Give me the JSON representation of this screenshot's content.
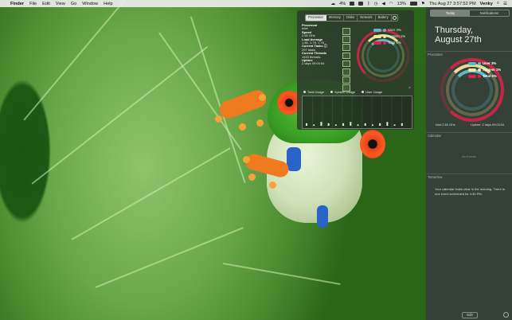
{
  "menubar": {
    "apple": "",
    "app": "Finder",
    "items": [
      "File",
      "Edit",
      "View",
      "Go",
      "Window",
      "Help"
    ],
    "status_percent": "4%",
    "battery": "13%",
    "datetime": "Thu Aug 27  3:57:52 PM",
    "user": "Venky"
  },
  "widget": {
    "tabs": [
      "Processor",
      "Memory",
      "Disks",
      "Network",
      "Battery"
    ],
    "active_tab": "Processor",
    "stats": [
      {
        "label": "Processor",
        "value": "Intel"
      },
      {
        "label": "Speed",
        "value": "2.50 GHz"
      },
      {
        "label": "Load Average",
        "value": "1.80, 1.79, 1.78"
      },
      {
        "label": "Current Tasks",
        "value": "297 tasks"
      },
      {
        "label": "Current Threads",
        "value": "1493 threads"
      },
      {
        "label": "Uptime",
        "value": "2 days 09:04:54"
      }
    ],
    "legend": [
      {
        "label": "User 4%",
        "color": "#5fb8c8"
      },
      {
        "label": "System 1%",
        "color": "#f2e6a0"
      },
      {
        "label": "Total 6%",
        "color": "#e0234a"
      }
    ],
    "graph_legend": [
      "Total Usage",
      "System Usage",
      "User Usage"
    ],
    "graph_values": [
      2,
      1,
      3,
      2,
      1,
      2,
      3,
      1,
      2,
      1,
      2,
      3,
      1,
      2
    ]
  },
  "nc": {
    "tabs": [
      "Today",
      "Notifications"
    ],
    "active_tab": "Today",
    "date_line1": "Thursday,",
    "date_line2": "August 27th",
    "processor_title": "Processor",
    "legend": [
      {
        "label": "User 3%",
        "color": "#5fb8c8"
      },
      {
        "label": "System 1%",
        "color": "#f2e6a0"
      },
      {
        "label": "Total 5%",
        "color": "#e0234a"
      }
    ],
    "footer_left": "Intel 2.50 GHz",
    "footer_right": "Uptime: 2 days 09:04:54",
    "calendar_title": "Calendar",
    "no_events": "No Events",
    "tomorrow_title": "Tomorrow",
    "tomorrow_text": "Your calendar looks clear in the morning. There is one event scheduled for 4:30 PM.",
    "edit": "Edit"
  }
}
